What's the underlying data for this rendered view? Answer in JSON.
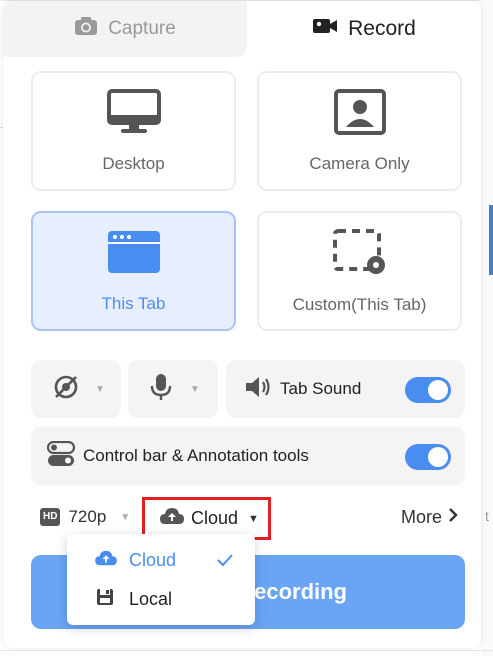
{
  "tabs": {
    "capture_label": "Capture",
    "record_label": "Record",
    "active": "Record"
  },
  "modes": {
    "desktop_label": "Desktop",
    "camera_only_label": "Camera Only",
    "this_tab_label": "This Tab",
    "custom_label": "Custom(This Tab)",
    "selected": "This Tab"
  },
  "controls": {
    "tab_sound_label": "Tab Sound",
    "tab_sound_on": true,
    "control_bar_label": "Control bar & Annotation tools",
    "control_bar_on": true
  },
  "settings": {
    "quality_badge": "HD",
    "quality_value": "720p",
    "storage_value": "Cloud",
    "more_label": "More"
  },
  "storage_menu": {
    "options": [
      {
        "label": "Cloud",
        "selected": true
      },
      {
        "label": "Local",
        "selected": false
      }
    ]
  },
  "primary_button_label": "ecording",
  "colors": {
    "accent": "#4a8df0",
    "primary_button": "#6aa4f5",
    "highlight": "#e02020",
    "active_card_bg": "#e7efff"
  }
}
